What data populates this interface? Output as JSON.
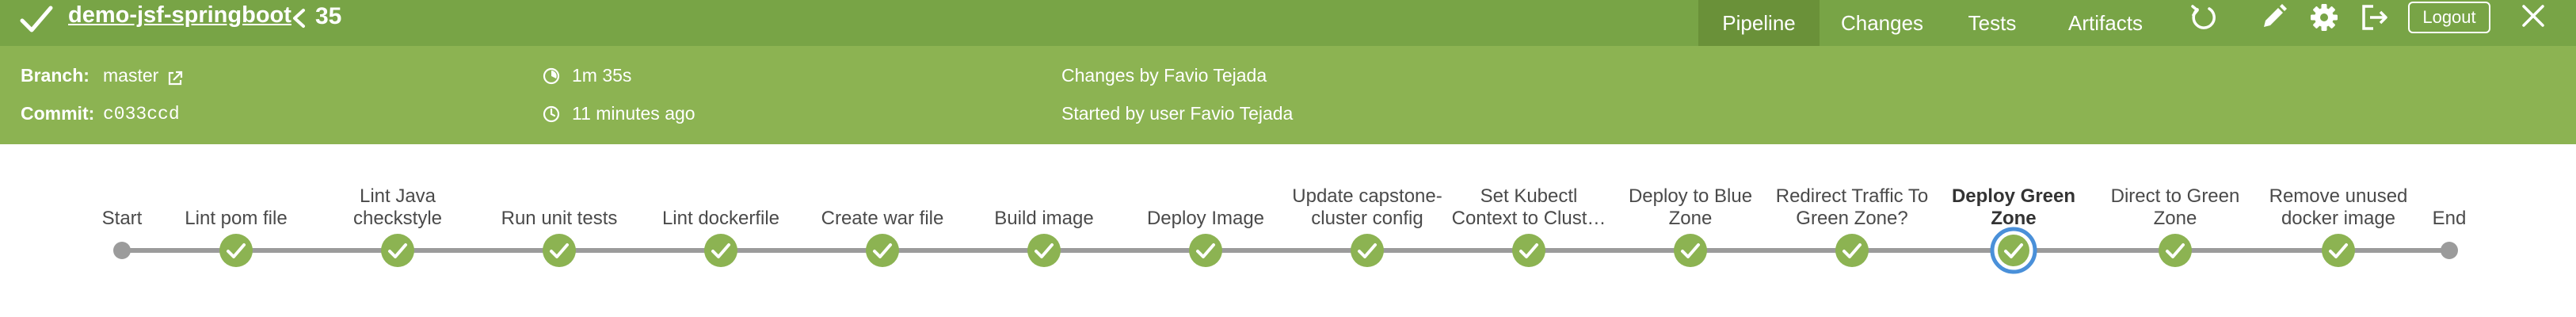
{
  "header": {
    "job_name": "demo-jsf-springboot",
    "run_number": "35",
    "tabs": [
      {
        "label": "Pipeline",
        "active": true
      },
      {
        "label": "Changes",
        "active": false
      },
      {
        "label": "Tests",
        "active": false
      },
      {
        "label": "Artifacts",
        "active": false
      }
    ],
    "tools": [
      "rerun-icon",
      "edit-icon",
      "gear-icon",
      "exit-icon"
    ],
    "logout_label": "Logout",
    "status": "success",
    "colors": {
      "topbar": "#78a446",
      "metabar": "#8cb352",
      "success": "#8cb352",
      "selected": "#4a90d9"
    }
  },
  "meta": {
    "branch_label": "Branch:",
    "branch_value": "master",
    "commit_label": "Commit:",
    "commit_value": "c033ccd",
    "duration": "1m 35s",
    "ago": "11 minutes ago",
    "changes_by": "Changes by Favio Tejada",
    "started_by": "Started by user Favio Tejada"
  },
  "pipeline": {
    "stages": [
      {
        "label": "Start",
        "status": "start"
      },
      {
        "label": "Lint pom file",
        "status": "success"
      },
      {
        "label": "Lint Java checkstyle",
        "status": "success"
      },
      {
        "label": "Run unit tests",
        "status": "success"
      },
      {
        "label": "Lint dockerfile",
        "status": "success"
      },
      {
        "label": "Create war file",
        "status": "success"
      },
      {
        "label": "Build image",
        "status": "success"
      },
      {
        "label": "Deploy Image",
        "status": "success"
      },
      {
        "label": "Update capstone-cluster config",
        "status": "success"
      },
      {
        "label": "Set Kubectl Context to Clust…",
        "status": "success"
      },
      {
        "label": "Deploy to Blue Zone",
        "status": "success"
      },
      {
        "label": "Redirect Traffic To Green Zone?",
        "status": "success"
      },
      {
        "label": "Deploy Green Zone",
        "status": "success",
        "selected": true
      },
      {
        "label": "Direct to Green Zone",
        "status": "success"
      },
      {
        "label": "Remove unused docker image",
        "status": "success"
      },
      {
        "label": "End",
        "status": "end"
      }
    ]
  }
}
